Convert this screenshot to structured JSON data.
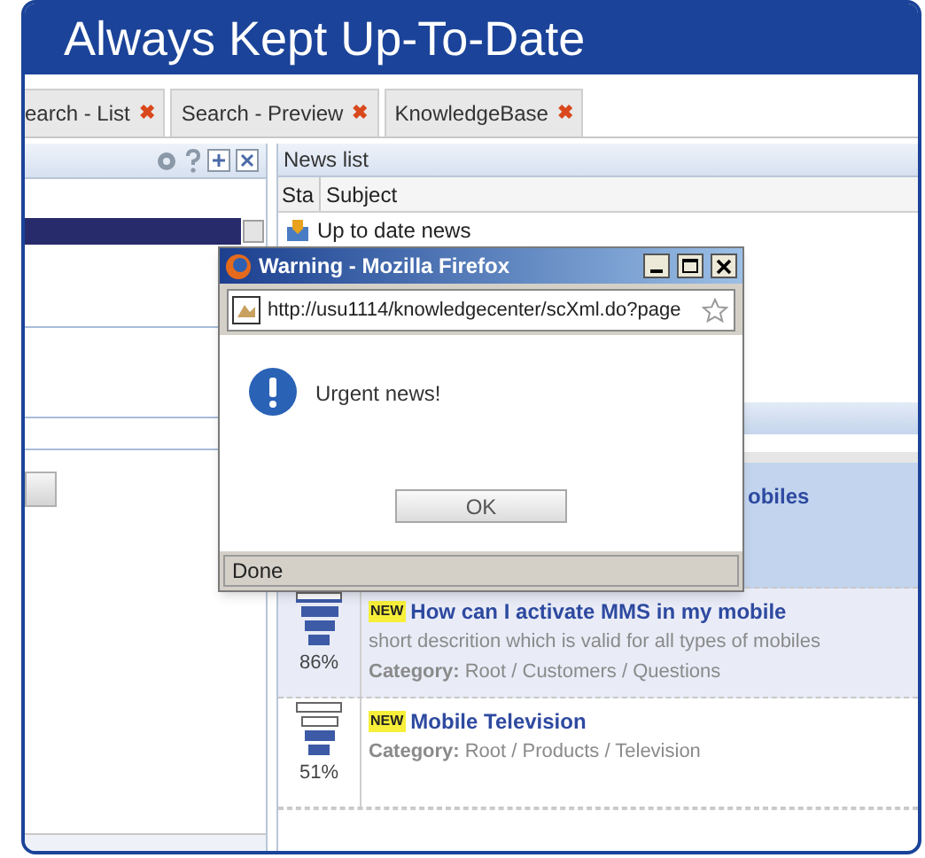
{
  "heading": "Always Kept Up-To-Date",
  "tabs": [
    {
      "label": "earch - List",
      "close": "✖"
    },
    {
      "label": "Search - Preview",
      "close": "✖"
    },
    {
      "label": "KnowledgeBase",
      "close": "✖"
    }
  ],
  "news_list": {
    "title": "News list",
    "columns": [
      "Sta",
      "Subject"
    ],
    "rows": [
      {
        "subject": "Up to date news"
      }
    ]
  },
  "knowledge_items": [
    {
      "title": "obiles",
      "selected": true
    },
    {
      "badge": "NEW",
      "title": "How can I activate MMS in my mobile",
      "description": "short descrition which is valid for all types of mobiles",
      "category_label": "Category:",
      "category": "Root / Customers / Questions",
      "level": 0.86,
      "reading": "86%",
      "selected": false
    },
    {
      "badge": "NEW",
      "title": "Mobile Television",
      "category_label": "Category:",
      "category": "Root / Products / Television",
      "level": 0.51,
      "reading": "51%",
      "selected": false
    }
  ],
  "dialog": {
    "title": "Warning - Mozilla Firefox",
    "url": "http://usu1114/knowledgecenter/scXml.do?page",
    "message": "Urgent news!",
    "button": "OK",
    "status": "Done"
  }
}
